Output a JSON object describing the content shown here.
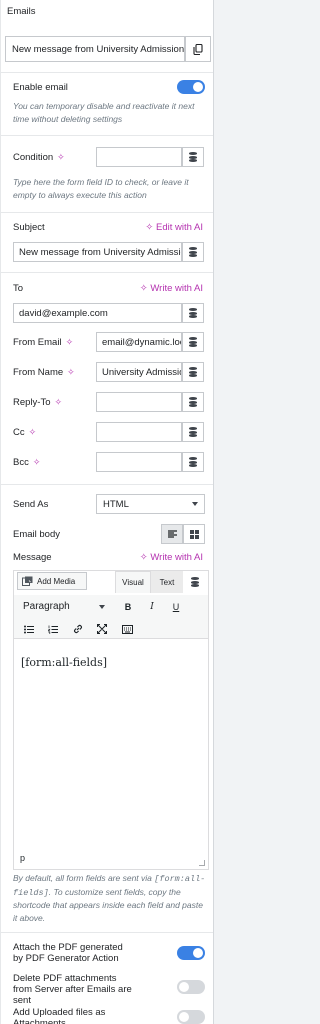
{
  "section": {
    "title": "Emails"
  },
  "email_title": {
    "value": "New message from University Admission"
  },
  "enable_email": {
    "label": "Enable email",
    "enabled": true,
    "help": "You can temporary disable and reactivate it next time without deleting settings"
  },
  "condition": {
    "label": "Condition",
    "value": "",
    "help": "Type here the form field ID to check, or leave it empty to always execute this action"
  },
  "subject": {
    "label": "Subject",
    "ai_link": "Edit with AI",
    "value": "New message from University Admission"
  },
  "to": {
    "label": "To",
    "ai_link": "Write with AI",
    "value": "david@example.com"
  },
  "from_email": {
    "label": "From Email",
    "value": "email@dynamic.localhost"
  },
  "from_name": {
    "label": "From Name",
    "value": "University Admission"
  },
  "reply_to": {
    "label": "Reply-To",
    "value": ""
  },
  "cc": {
    "label": "Cc",
    "value": ""
  },
  "bcc": {
    "label": "Bcc",
    "value": ""
  },
  "send_as": {
    "label": "Send As",
    "selected": "HTML"
  },
  "email_body": {
    "label": "Email body"
  },
  "message": {
    "label": "Message",
    "ai_link": "Write with AI",
    "add_media": "Add Media",
    "tab_visual": "Visual",
    "tab_text": "Text",
    "format_select": "Paragraph",
    "content": "[form:all-fields]",
    "status_path": "p"
  },
  "message_help": {
    "part1": "By default, all form fields are sent via ",
    "shortcode": "[form:all-fields]",
    "part2": ". To customize sent fields, copy the shortcode that appears inside each field and paste it above."
  },
  "attach_pdf": {
    "label": "Attach the PDF generated by PDF Generator Action",
    "enabled": true
  },
  "delete_pdf": {
    "label": "Delete PDF attachments from Server after Emails are sent",
    "enabled": false
  },
  "add_uploaded": {
    "label": "Add Uploaded files as Attachments",
    "enabled": false
  },
  "colors": {
    "accent": "#3a81e4",
    "ai": "#b533b0",
    "help_text": "#6d7882"
  }
}
